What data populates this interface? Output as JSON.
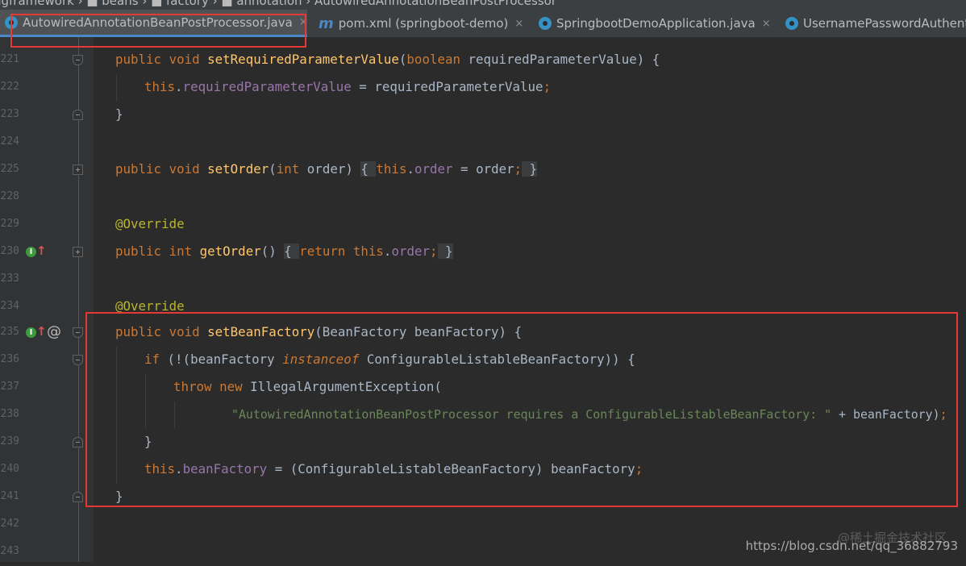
{
  "breadcrumb": "ngframework › ■ beans › ■ factory › ■ annotation › AutowiredAnnotationBeanPostProcessor",
  "tabs": [
    {
      "label": "AutowiredAnnotationBeanPostProcessor.java",
      "icon": "class-icon",
      "active": true
    },
    {
      "label": "pom.xml (springboot-demo)",
      "icon": "maven-icon",
      "active": false
    },
    {
      "label": "SpringbootDemoApplication.java",
      "icon": "class-icon",
      "active": false
    },
    {
      "label": "UsernamePasswordAuthent",
      "icon": "class-icon",
      "active": false
    }
  ],
  "close_glyph": "×",
  "line_numbers": [
    "221",
    "222",
    "223",
    "224",
    "225",
    "228",
    "229",
    "230",
    "233",
    "234",
    "235",
    "236",
    "237",
    "238",
    "239",
    "240",
    "241",
    "242",
    "243"
  ],
  "code": {
    "l221": [
      "public void ",
      "setRequiredParameterValue",
      "(",
      "boolean ",
      "requiredParameterValue) {"
    ],
    "l222": [
      "this",
      ".",
      "requiredParameterValue",
      " = requiredParameterValue",
      ";"
    ],
    "l223": [
      "}"
    ],
    "l225": [
      "public void ",
      "setOrder",
      "(",
      "int ",
      "order) ",
      "{ ",
      "this",
      ".",
      "order",
      " = order",
      ";",
      " }"
    ],
    "l229": [
      "@Override"
    ],
    "l230": [
      "public int ",
      "getOrder",
      "() ",
      "{ ",
      "return this",
      ".",
      "order",
      ";",
      " }"
    ],
    "l234": [
      "@Override"
    ],
    "l235": [
      "public void ",
      "setBeanFactory",
      "(BeanFactory beanFactory) {"
    ],
    "l236": [
      "if ",
      "(!(beanFactory ",
      "instanceof ",
      "ConfigurableListableBeanFactory)) {"
    ],
    "l237": [
      "throw new ",
      "IllegalArgumentException("
    ],
    "l238": [
      "\"AutowiredAnnotationBeanPostProcessor requires a ConfigurableListableBeanFactory: \"",
      " + beanFactory)",
      ";"
    ],
    "l239": [
      "}"
    ],
    "l240": [
      "this",
      ".",
      "beanFactory",
      " = (ConfigurableListableBeanFactory) beanFactory",
      ";"
    ],
    "l241": [
      "}"
    ]
  },
  "gutter_marks": {
    "implements": "I",
    "at": "@",
    "arrow": "↑"
  },
  "watermark": {
    "site": "@稀土掘金技术社区",
    "url": "https://blog.csdn.net/qq_36882793"
  },
  "colors": {
    "keyword": "#cc7832",
    "method": "#ffc66d",
    "field": "#9876aa",
    "annotation": "#bbb529",
    "string": "#6a8759",
    "highlight": "#e53935"
  }
}
